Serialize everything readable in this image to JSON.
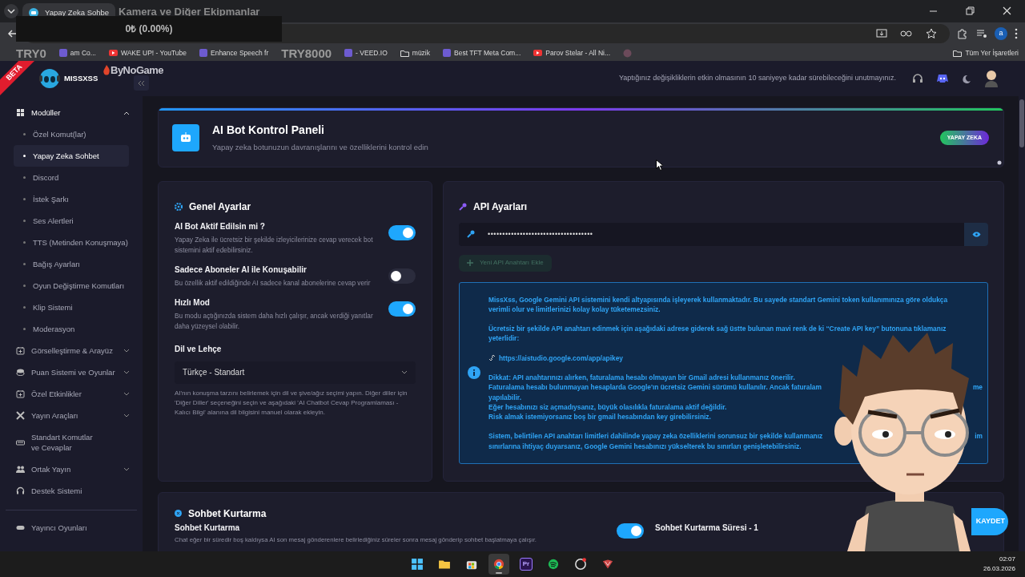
{
  "browser": {
    "tab_title": "Yapay Zeka Sohbe",
    "profile_initial": "a",
    "all_bookmarks": "Tüm Yer İşaretleri",
    "bookmarks": [
      {
        "kind": "site",
        "text": "am Co..."
      },
      {
        "kind": "youtube",
        "text": "WAKE UP! - YouTube"
      },
      {
        "kind": "site",
        "text": "Enhance Speech fr"
      },
      {
        "kind": "site",
        "text": "- VEED.IO"
      },
      {
        "kind": "folder",
        "text": "müzik"
      },
      {
        "kind": "site",
        "text": "Best TFT Meta Com..."
      },
      {
        "kind": "youtube",
        "text": "Parov Stelar - All Ni..."
      },
      {
        "kind": "icon"
      }
    ]
  },
  "stream_overlay": {
    "title": "Kamera ve Diğer Ekipmanlar",
    "donation_total": "0₺ (0.00%)",
    "goal_start": "TRY0",
    "goal_end": "TRY8000",
    "sponsor": "ByNoGame"
  },
  "header": {
    "beta": "BETA",
    "brand": "MISSXSS",
    "notice": "Yaptığınız değişikliklerin etkin olmasının 10 saniyeye kadar sürebileceğini unutmayınız."
  },
  "sidebar": {
    "items": [
      {
        "kind": "group",
        "label": "Modüller",
        "expanded": true,
        "children": [
          {
            "label": "Özel Komut(lar)",
            "selected": false
          },
          {
            "label": "Yapay Zeka Sohbet",
            "selected": true
          },
          {
            "label": "Discord",
            "selected": false
          },
          {
            "label": "İstek Şarkı",
            "selected": false
          },
          {
            "label": "Ses Alertleri",
            "selected": false
          },
          {
            "label": "TTS (Metinden Konuşmaya)",
            "selected": false
          },
          {
            "label": "Bağış Ayarları",
            "selected": false
          },
          {
            "label": "Oyun Değiştirme Komutları",
            "selected": false
          },
          {
            "label": "Klip Sistemi",
            "selected": false
          },
          {
            "label": "Moderasyon",
            "selected": false
          }
        ]
      },
      {
        "kind": "group",
        "label": "Görselleştirme & Arayüz",
        "expanded": false
      },
      {
        "kind": "group",
        "label": "Puan Sistemi ve Oyunlar",
        "expanded": false
      },
      {
        "kind": "group",
        "label": "Özel Etkinlikler",
        "expanded": false
      },
      {
        "kind": "group",
        "label": "Yayın Araçları",
        "expanded": false
      },
      {
        "kind": "link",
        "label": "Standart Komutlar ve Cevaplar"
      },
      {
        "kind": "group",
        "label": "Ortak Yayın",
        "expanded": false
      },
      {
        "kind": "link",
        "label": "Destek Sistemi"
      }
    ],
    "footer_items": [
      {
        "kind": "link",
        "label": "Yayıncı Oyunları"
      }
    ]
  },
  "page_header": {
    "title": "AI Bot Kontrol Paneli",
    "subtitle": "Yapay zeka botunuzun davranışlarını ve özelliklerini kontrol edin",
    "badge": "YAPAY ZEKA"
  },
  "general": {
    "title": "Genel Ayarlar",
    "settings": [
      {
        "label": "AI Bot Aktif Edilsin mi ?",
        "description": "Yapay Zeka ile ücretsiz bir şekilde izleyicilerinize cevap verecek bot sistemini aktif edebilirsiniz.",
        "on": true
      },
      {
        "label": "Sadece Aboneler AI ile Konuşabilir",
        "description": "Bu özellik aktif edildiğinde AI sadece kanal abonelerine cevap verir",
        "on": false
      },
      {
        "label": "Hızlı Mod",
        "description": "Bu modu açtığınızda sistem daha hızlı çalışır, ancak verdiği yanıtlar daha yüzeysel olabilir.",
        "on": true
      }
    ],
    "language_label": "Dil ve Lehçe",
    "language_value": "Türkçe - Standart",
    "language_help": "AI'nın konuşma tarzını belirlemek için dil ve şive/ağız seçimi yapın. Diğer diller için 'Diğer Diller' seçeneğini seçin ve aşağıdaki 'AI Chatbot Cevap Programlaması - Kalıcı Bilgi' alanına dil bilgisini manuel olarak ekleyin."
  },
  "api": {
    "title": "API Ayarları",
    "key_value": "••••••••••••••••••••••••••••••••••••",
    "add_button": {
      "label": "Yeni API Anahtarı Ekle",
      "disabled": true
    },
    "info_blocks": [
      {
        "kind": "text",
        "lines": [
          {
            "text": "MissXss, Google Gemini API sistemini kendi altyapısında işleyerek kullanmaktadır. Bu sayede standart Gemini token kullanımınıza göre oldukça"
          },
          {
            "text": "verimli olur ve limitlerinizi kolay kolay tüketemezsiniz."
          }
        ]
      },
      {
        "kind": "text",
        "lines": [
          {
            "text": "Ücretsiz bir şekilde API anahtarı edinmek için aşağıdaki adrese giderek sağ üstte bulunan mavi renk de ki “Create API key” butonuna tıklamanız"
          },
          {
            "text": "yeterlidir:"
          }
        ]
      },
      {
        "kind": "link",
        "text": "https://aistudio.google.com/app/apikey"
      },
      {
        "kind": "text",
        "lines": [
          {
            "text": "Dikkat: API anahtarınızı alırken, faturalama hesabı olmayan bir Gmail adresi kullanmanız önerilir."
          },
          {
            "text": "Faturalama hesabı bulunmayan hesaplarda Google'ın ücretsiz Gemini sürümü kullanılır. Ancak faturalam",
            "tail": "me"
          },
          {
            "text": "yapılabilir."
          },
          {
            "text": "Eğer hesabınızı siz açmadıysanız, büyük olasılıkla faturalama aktif değildir."
          },
          {
            "text": "Risk almak istemiyorsanız boş bir gmail hesabından key girebilirsiniz."
          }
        ]
      },
      {
        "kind": "text",
        "lines": [
          {
            "text": "Sistem, belirtilen API anahtarı limitleri dahilinde yapay zeka özelliklerini sorunsuz bir şekilde kullanmanız",
            "tail": "im"
          },
          {
            "text": "sınırlarına ihtiyaç duyarsanız, Google Gemini hesabınızı yükselterek bu sınırları genişletebilirsiniz."
          }
        ]
      }
    ]
  },
  "recovery": {
    "title": "Sohbet Kurtarma",
    "label": "Sohbet Kurtarma",
    "description": "Chat eğer bir süredir boş kaldıysa AI son mesaj gönderenlere belirlediğiniz süreler sonra mesaj gönderip sohbet başlatmaya çalışır.",
    "on": true,
    "duration_label": "Sohbet Kurtarma Süresi - 1"
  },
  "save_button": "KAYDET",
  "taskbar": {
    "apps": [
      {
        "kind": "windows",
        "selected": false
      },
      {
        "kind": "folder",
        "selected": false
      },
      {
        "kind": "store",
        "selected": false
      },
      {
        "kind": "browser",
        "selected": true
      },
      {
        "kind": "premiere",
        "label": "Pr",
        "selected": false
      },
      {
        "kind": "music",
        "selected": false
      },
      {
        "kind": "recorder",
        "selected": false
      },
      {
        "kind": "bot",
        "selected": false
      }
    ],
    "time": "02:07",
    "date": "26.03.2026"
  }
}
